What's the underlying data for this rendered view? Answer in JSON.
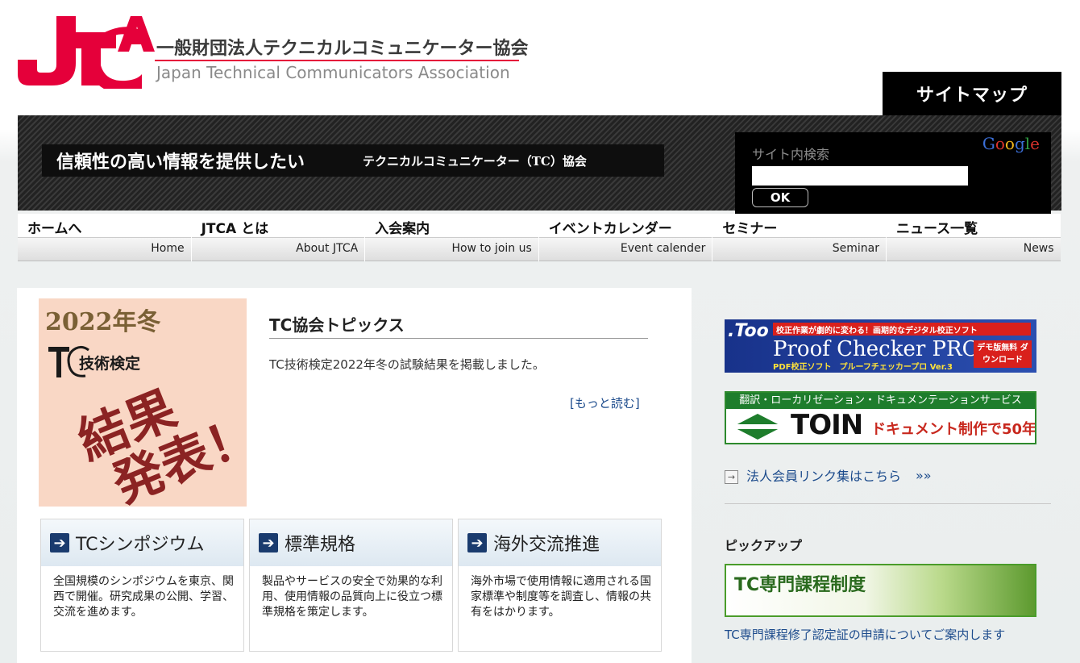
{
  "header": {
    "logo_ja": "一般財団法人テクニカルコミュニケーター協会",
    "logo_en": "Japan Technical Communicators Association",
    "sitemap_label": "サイトマップ"
  },
  "banner": {
    "tagline_main": "信頼性の高い情報を提供したい",
    "tagline_sub": "テクニカルコミュニケーター（TC）協会"
  },
  "search": {
    "label": "サイト内検索",
    "input_value": "",
    "ok_label": "OK",
    "google_label": "Google"
  },
  "nav": {
    "items": [
      {
        "ja": "ホームへ",
        "en": "Home"
      },
      {
        "ja": "JTCA とは",
        "en": "About JTCA"
      },
      {
        "ja": "入会案内",
        "en": "How to join us"
      },
      {
        "ja": "イベントカレンダー",
        "en": "Event calender"
      },
      {
        "ja": "セミナー",
        "en": "Seminar"
      },
      {
        "ja": "ニュース一覧",
        "en": "News"
      }
    ]
  },
  "feature": {
    "img_year": "2022年冬",
    "img_tc": "技術検定",
    "img_result_1": "結果",
    "img_result_2": "発表！"
  },
  "topics": {
    "title": "TC協会トピックス",
    "body": "TC技術検定2022年冬の試験結果を掲載しました。",
    "read_more": "[もっと読む]"
  },
  "cards": [
    {
      "title": "TCシンポジウム",
      "body": "全国規模のシンポジウムを東京、関西で開催。研究成果の公開、学習、交流を進めます。"
    },
    {
      "title": "標準規格",
      "body": "製品やサービスの安全で効果的な利用、使用情報の品質向上に役立つ標準規格を策定します。"
    },
    {
      "title": "海外交流推進",
      "body": "海外市場で使用情報に適用される国家標準や制度等を調査し、情報の共有をはかります。"
    }
  ],
  "sidebar": {
    "ad1": {
      "brand": ".Too",
      "strip": "校正作業が劇的に変わる！画期的なデジタル校正ソフト",
      "title": "Proof Checker PRO",
      "sub": "PDF校正ソフト　プルーフチェッカープロ Ver.3",
      "demo": "デモ版無料 ダウンロード"
    },
    "ad2": {
      "strip": "翻訳・ローカリゼーション・ドキュメンテーションサービス",
      "brand": "TOIN",
      "text": "ドキュメント制作で50年"
    },
    "member_link": "法人会員リンク集はこちら",
    "member_link_more": "»»",
    "pickup_title": "ピックアップ",
    "pickup_banner": "TC専門課程制度",
    "pickup_desc": "TC専門課程修了認定証の申請についてご案内します"
  },
  "colors": {
    "brand_red": "#e5003a",
    "link_blue": "#1c4b8c",
    "card_arrow": "#1a3b6e"
  }
}
